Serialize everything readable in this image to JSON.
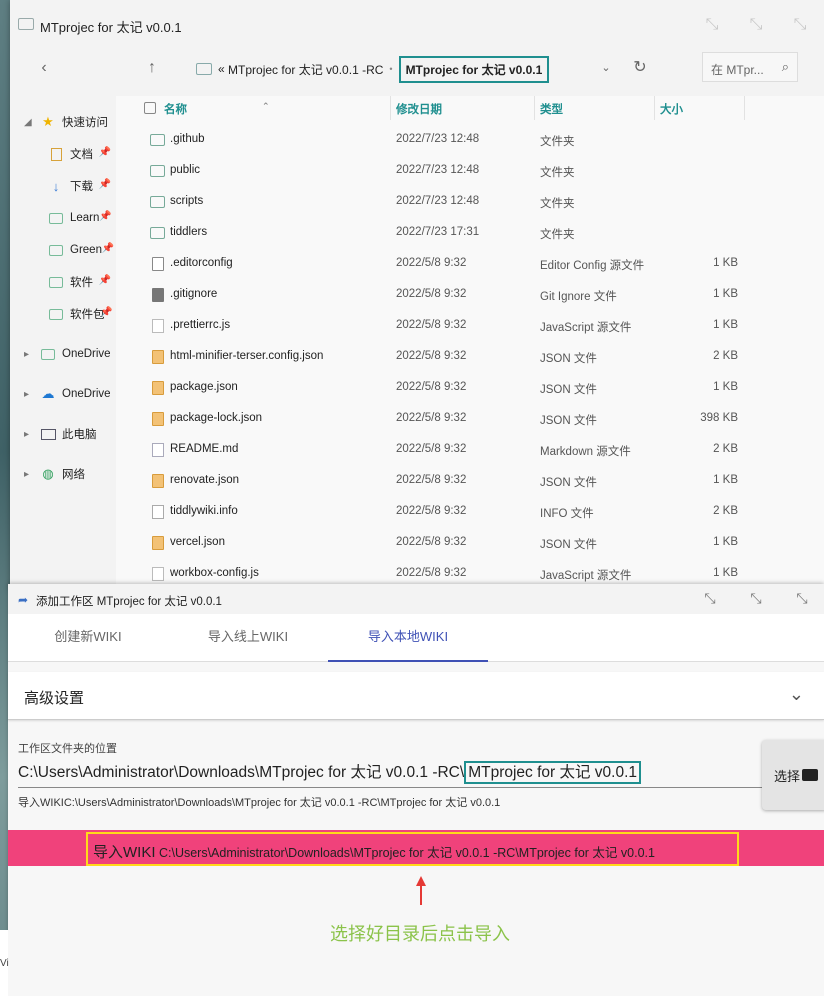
{
  "explorer": {
    "title": "MTprojec for 太记 v0.0.1",
    "breadcrumb": {
      "overflow": "«",
      "parent": "MTprojec for 太记 v0.0.1 -RC",
      "separator": "•",
      "current": "MTprojec for 太记 v0.0.1"
    },
    "search_placeholder": "在 MTpr...",
    "sidebar": [
      {
        "label": "快速访问",
        "icon": "star-icon"
      },
      {
        "label": "文档",
        "icon": "document-icon"
      },
      {
        "label": "下载",
        "icon": "download-icon"
      },
      {
        "label": "Learn",
        "icon": "folder-icon"
      },
      {
        "label": "Green",
        "icon": "folder-icon"
      },
      {
        "label": "软件",
        "icon": "folder-icon"
      },
      {
        "label": "软件包",
        "icon": "folder-icon"
      },
      {
        "label": "OneDrive",
        "icon": "folder-icon"
      },
      {
        "label": "OneDrive",
        "icon": "cloud-icon"
      },
      {
        "label": "此电脑",
        "icon": "computer-icon"
      },
      {
        "label": "网络",
        "icon": "network-icon"
      }
    ],
    "columns": {
      "name": "名称",
      "date": "修改日期",
      "type": "类型",
      "size": "大小"
    },
    "files": [
      {
        "name": ".github",
        "date": "2022/7/23 12:48",
        "type": "文件夹",
        "size": "",
        "icon": "folder"
      },
      {
        "name": "public",
        "date": "2022/7/23 12:48",
        "type": "文件夹",
        "size": "",
        "icon": "folder"
      },
      {
        "name": "scripts",
        "date": "2022/7/23 12:48",
        "type": "文件夹",
        "size": "",
        "icon": "folder"
      },
      {
        "name": "tiddlers",
        "date": "2022/7/23 17:31",
        "type": "文件夹",
        "size": "",
        "icon": "folder"
      },
      {
        "name": ".editorconfig",
        "date": "2022/5/8 9:32",
        "type": "Editor Config 源文件",
        "size": "1 KB",
        "icon": "gear"
      },
      {
        "name": ".gitignore",
        "date": "2022/5/8 9:32",
        "type": "Git Ignore 文件",
        "size": "1 KB",
        "icon": "git"
      },
      {
        "name": ".prettierrc.js",
        "date": "2022/5/8 9:32",
        "type": "JavaScript 源文件",
        "size": "1 KB",
        "icon": "js"
      },
      {
        "name": "html-minifier-terser.config.json",
        "date": "2022/5/8 9:32",
        "type": "JSON 文件",
        "size": "2 KB",
        "icon": "json"
      },
      {
        "name": "package.json",
        "date": "2022/5/8 9:32",
        "type": "JSON 文件",
        "size": "1 KB",
        "icon": "json"
      },
      {
        "name": "package-lock.json",
        "date": "2022/5/8 9:32",
        "type": "JSON 文件",
        "size": "398 KB",
        "icon": "json"
      },
      {
        "name": "README.md",
        "date": "2022/5/8 9:32",
        "type": "Markdown 源文件",
        "size": "2 KB",
        "icon": "md"
      },
      {
        "name": "renovate.json",
        "date": "2022/5/8 9:32",
        "type": "JSON 文件",
        "size": "1 KB",
        "icon": "json"
      },
      {
        "name": "tiddlywiki.info",
        "date": "2022/5/8 9:32",
        "type": "INFO 文件",
        "size": "2 KB",
        "icon": "info"
      },
      {
        "name": "vercel.json",
        "date": "2022/5/8 9:32",
        "type": "JSON 文件",
        "size": "1 KB",
        "icon": "json"
      },
      {
        "name": "workbox-config.js",
        "date": "2022/5/8 9:32",
        "type": "JavaScript 源文件",
        "size": "1 KB",
        "icon": "js"
      }
    ]
  },
  "dialog": {
    "title": "添加工作区 MTprojec for 太记 v0.0.1",
    "tabs": [
      "创建新WIKI",
      "导入线上WIKI",
      "导入本地WIKI"
    ],
    "active_tab": 2,
    "advanced_label": "高级设置",
    "folder_label": "工作区文件夹的位置",
    "folder_value_prefix": "C:\\Users\\Administrator\\Downloads\\MTprojec for 太记 v0.0.1 -RC\\",
    "folder_value_highlight": "MTprojec for 太记 v0.0.1",
    "choose_label": "选择",
    "hint_path": "导入WIKIC:\\Users\\Administrator\\Downloads\\MTprojec for 太记 v0.0.1 -RC\\MTprojec for 太记 v0.0.1",
    "import_label": "导入WIKI",
    "import_path": " C:\\Users\\Administrator\\Downloads\\MTprojec for 太记 v0.0.1 -RC\\MTprojec for 太记 v0.0.1",
    "annotation": "选择好目录后点击导入"
  },
  "left_strip_text": "Vi",
  "colors": {
    "accent": "#3f51b5",
    "import_bg": "#f0427b",
    "highlight_box": "#1f8f8f",
    "annotation": "#8bc34a",
    "callout_border": "#ffd91a"
  }
}
